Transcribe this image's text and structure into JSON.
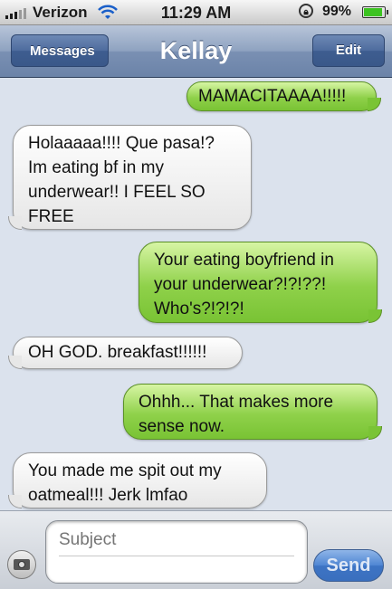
{
  "status_bar": {
    "carrier": "Verizon",
    "time": "11:29 AM",
    "battery_percent": "99",
    "battery_percent_suffix": "%",
    "signal_icon": "signal-bars-icon",
    "wifi_icon": "wifi-icon",
    "rotation_lock_icon": "rotation-lock-icon",
    "battery_icon": "battery-icon",
    "battery_level": 0.99,
    "battery_color": "#3cc321"
  },
  "nav": {
    "back_label": "Messages",
    "title": "Kellay",
    "edit_label": "Edit"
  },
  "messages": [
    {
      "direction": "outgoing",
      "text": "MAMACITAAAA!!!!!"
    },
    {
      "direction": "incoming",
      "text": "Holaaaaa!!!! Que pasa!?\nIm eating bf in my\nunderwear!! I FEEL SO\nFREE"
    },
    {
      "direction": "outgoing",
      "text": "Your eating boyfriend in\nyour underwear?!?!??!\nWho's?!?!?!"
    },
    {
      "direction": "incoming",
      "text": "OH GOD. breakfast!!!!!!"
    },
    {
      "direction": "outgoing",
      "text": "Ohhh... That makes more\nsense now."
    },
    {
      "direction": "incoming",
      "text": "You made me spit out my\noatmeal!!! Jerk lmfao"
    }
  ],
  "compose": {
    "camera_icon": "camera-icon",
    "subject_placeholder": "Subject",
    "send_label": "Send"
  },
  "colors": {
    "outgoing_bubble": "#8fd14a",
    "incoming_bubble": "#ffffff",
    "background": "#dbe2ed",
    "nav_bar": "#7a90b3"
  }
}
